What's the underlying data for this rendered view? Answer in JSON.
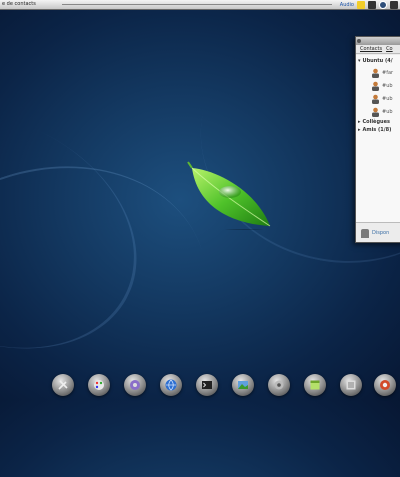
{
  "topbar": {
    "window_title": "e de contacts",
    "tray_text": "Audio"
  },
  "desktop": {
    "wallpaper": "leaf-wallpaper",
    "colors": {
      "background": "#143a63",
      "leaf": "#4fc22a"
    }
  },
  "contacts_window": {
    "menu": [
      "Contacts",
      "Co"
    ],
    "groups": [
      {
        "label": "Ubuntu (4/",
        "expanded": true
      },
      {
        "label": "Collègues",
        "expanded": false
      },
      {
        "label": "Amis (1/8)",
        "expanded": false
      }
    ],
    "contacts": [
      "#far",
      "#ub",
      "#ub",
      "#ub"
    ],
    "status": "Dispon"
  },
  "dock": {
    "icons": [
      "tools-icon",
      "palette-icon",
      "media-player-icon",
      "web-browser-icon",
      "terminal-icon",
      "image-viewer-icon",
      "settings-icon",
      "calendar-icon",
      "file-manager-icon",
      "system-icon"
    ]
  }
}
